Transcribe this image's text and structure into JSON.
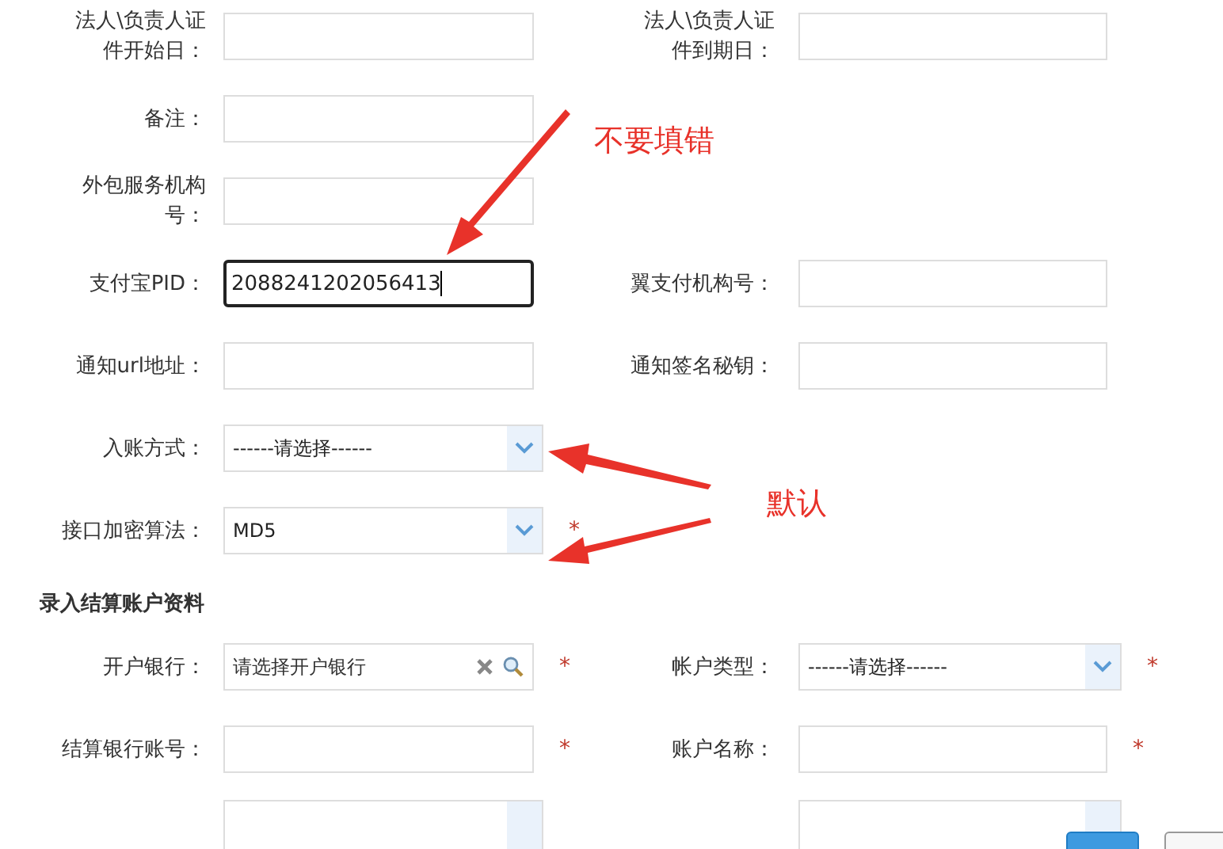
{
  "rows": [
    {
      "kind": "fields",
      "left": {
        "label": "法人\\负责人证件开始日：",
        "kind": "text"
      },
      "right": {
        "label": "法人\\负责人证件到期日：",
        "kind": "text"
      }
    },
    {
      "kind": "fields",
      "left": {
        "label": "备注：",
        "kind": "text"
      }
    },
    {
      "kind": "fields",
      "left": {
        "label": "外包服务机构号：",
        "kind": "text"
      }
    },
    {
      "kind": "fields",
      "left": {
        "label": "支付宝PID：",
        "kind": "text",
        "value": "2088241202056413",
        "focused": true
      },
      "right": {
        "label": "翼支付机构号：",
        "kind": "text"
      }
    },
    {
      "kind": "fields",
      "left": {
        "label": "通知url地址：",
        "kind": "text"
      },
      "right": {
        "label": "通知签名秘钥：",
        "kind": "text"
      }
    },
    {
      "kind": "fields",
      "left": {
        "label": "入账方式：",
        "kind": "select",
        "value": "------请选择------"
      }
    },
    {
      "kind": "fields",
      "left": {
        "label": "接口加密算法：",
        "kind": "select",
        "value": "MD5",
        "required_mark": "*"
      }
    },
    {
      "kind": "section",
      "title": "录入结算账户资料"
    },
    {
      "kind": "fields",
      "left": {
        "label": "开户银行：",
        "kind": "search",
        "placeholder": "请选择开户银行",
        "required_mark": "*"
      },
      "right": {
        "label": "帐户类型：",
        "kind": "select",
        "value": "------请选择------",
        "required_mark": "*"
      }
    },
    {
      "kind": "fields",
      "left": {
        "label": "结算银行账号：",
        "kind": "text",
        "required_mark": "*"
      },
      "right": {
        "label": "账户名称：",
        "kind": "text",
        "required_mark": "*"
      }
    },
    {
      "kind": "cut",
      "left": {
        "kind": "select"
      },
      "right": {
        "kind": "select"
      }
    }
  ],
  "annotations": [
    {
      "text": "不要填错"
    },
    {
      "text": "默认"
    }
  ],
  "buttons": [
    {
      "kind": "primary"
    },
    {
      "kind": "default"
    }
  ]
}
